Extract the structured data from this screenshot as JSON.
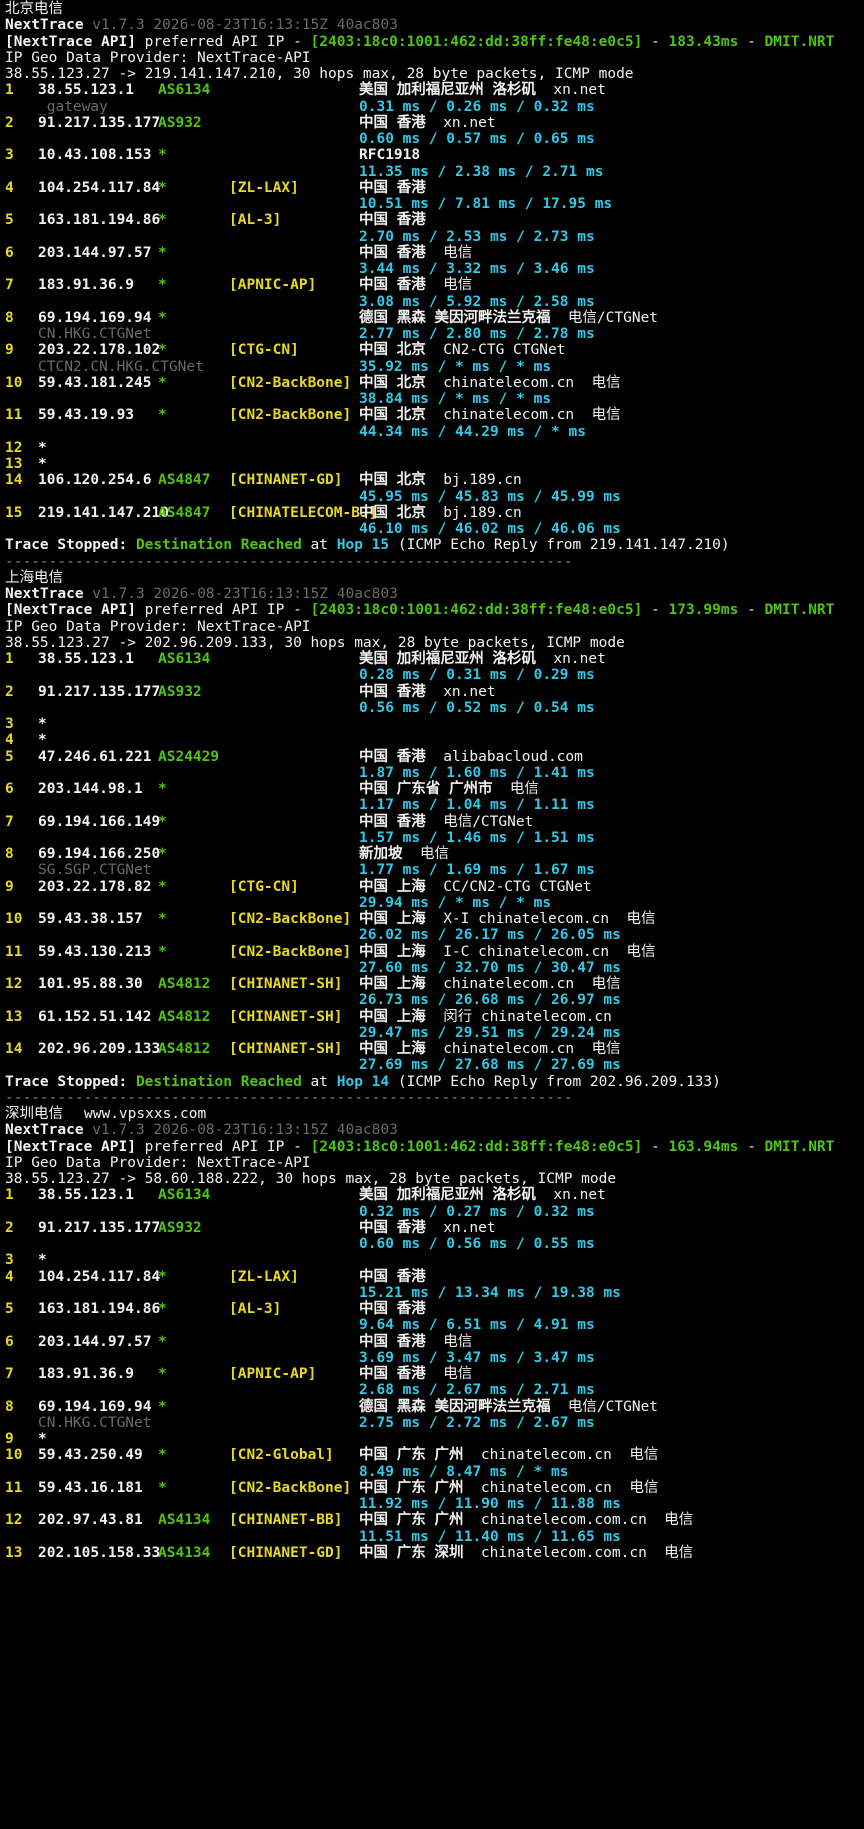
{
  "sections": [
    {
      "caption": "北京电信",
      "header": {
        "name": "NextTrace",
        "version": "v1.7.3 2026-08-23T16:13:15Z 40ac803",
        "api_prefix": "[NextTrace API]",
        "api_mid": " preferred API IP - ",
        "api_ip": "[2403:18c0:1001:462:dd:38ff:fe48:e0c5]",
        "api_dash": " - ",
        "api_latency": "183.43ms",
        "api_dash2": " - ",
        "api_loc": "DMIT.NRT",
        "geo": "IP Geo Data Provider: NextTrace-API",
        "trace": "38.55.123.27 -> 219.141.147.210, 30 hops max, 28 byte packets, ICMP mode"
      },
      "hops": [
        {
          "n": "1",
          "ip": "38.55.123.1",
          "as": "AS6134",
          "tag": "",
          "geo": "美国 加利福尼亚州 洛杉矶",
          "geo2": "xn.net",
          "rdns": "_gateway",
          "rtt": "0.31 ms / 0.26 ms / 0.32 ms"
        },
        {
          "n": "2",
          "ip": "91.217.135.177",
          "as": "AS932",
          "tag": "",
          "geo": "中国 香港",
          "geo2": "xn.net",
          "rdns": "",
          "rtt": "0.60 ms / 0.57 ms / 0.65 ms"
        },
        {
          "n": "3",
          "ip": "10.43.108.153",
          "as": "*",
          "tag": "",
          "geo": "RFC1918",
          "geo2": "",
          "rdns": "",
          "rtt": "11.35 ms / 2.38 ms / 2.71 ms"
        },
        {
          "n": "4",
          "ip": "104.254.117.84",
          "as": "*",
          "tag": "[ZL-LAX]",
          "geo": "中国 香港",
          "geo2": "",
          "rdns": "",
          "rtt": "10.51 ms / 7.81 ms / 17.95 ms"
        },
        {
          "n": "5",
          "ip": "163.181.194.86",
          "as": "*",
          "tag": "[AL-3]",
          "geo": "中国 香港",
          "geo2": "",
          "rdns": "",
          "rtt": "2.70 ms / 2.53 ms / 2.73 ms"
        },
        {
          "n": "6",
          "ip": "203.144.97.57",
          "as": "*",
          "tag": "",
          "geo": "中国 香港",
          "geo2": "电信",
          "rdns": "",
          "rtt": "3.44 ms / 3.32 ms / 3.46 ms"
        },
        {
          "n": "7",
          "ip": "183.91.36.9",
          "as": "*",
          "tag": "[APNIC-AP]",
          "geo": "中国 香港",
          "geo2": "电信",
          "rdns": "",
          "rtt": "3.08 ms / 5.92 ms / 2.58 ms"
        },
        {
          "n": "8",
          "ip": "69.194.169.94",
          "as": "*",
          "tag": "",
          "geo": "德国 黑森 美因河畔法兰克福",
          "geo2": "电信/CTGNet",
          "rdns": "CN.HKG.CTGNet",
          "rtt": "2.77 ms / 2.80 ms / 2.78 ms"
        },
        {
          "n": "9",
          "ip": "203.22.178.102",
          "as": "*",
          "tag": "[CTG-CN]",
          "geo": "中国 北京",
          "geo2": "CN2-CTG CTGNet",
          "rdns": "CTCN2.CN.HKG.CTGNet",
          "rtt": "35.92 ms / * ms / * ms"
        },
        {
          "n": "10",
          "ip": "59.43.181.245",
          "as": "*",
          "tag": "[CN2-BackBone]",
          "geo": "中国 北京",
          "geo2": "chinatelecom.cn  电信",
          "rdns": "",
          "rtt": "38.84 ms / * ms / * ms"
        },
        {
          "n": "11",
          "ip": "59.43.19.93",
          "as": "*",
          "tag": "[CN2-BackBone]",
          "geo": "中国 北京",
          "geo2": "chinatelecom.cn  电信",
          "rdns": "",
          "rtt": "44.34 ms / 44.29 ms / * ms"
        },
        {
          "n": "12",
          "ip": "*",
          "as": "",
          "tag": "",
          "geo": "",
          "geo2": "",
          "rdns": "",
          "rtt": ""
        },
        {
          "n": "13",
          "ip": "*",
          "as": "",
          "tag": "",
          "geo": "",
          "geo2": "",
          "rdns": "",
          "rtt": ""
        },
        {
          "n": "14",
          "ip": "106.120.254.6",
          "as": "AS4847",
          "tag": "[CHINANET-GD]",
          "geo": "中国 北京",
          "geo2": "bj.189.cn",
          "rdns": "",
          "rtt": "45.95 ms / 45.83 ms / 45.99 ms"
        },
        {
          "n": "15",
          "ip": "219.141.147.210",
          "as": "AS4847",
          "tag": "[CHINATELECOM-BJ]",
          "geo": "中国 北京",
          "geo2": "bj.189.cn",
          "rdns": "",
          "rtt": "46.10 ms / 46.02 ms / 46.06 ms"
        }
      ],
      "footer": {
        "a": "Trace Stopped: ",
        "b": "Destination Reached",
        "c": " at ",
        "d": "Hop 15",
        "e": " (ICMP Echo Reply from 219.141.147.210)"
      },
      "separator": "-----------------------------------------------------------------"
    },
    {
      "caption": "上海电信",
      "header": {
        "name": "NextTrace",
        "version": "v1.7.3 2026-08-23T16:13:15Z 40ac803",
        "api_prefix": "[NextTrace API]",
        "api_mid": " preferred API IP - ",
        "api_ip": "[2403:18c0:1001:462:dd:38ff:fe48:e0c5]",
        "api_dash": " - ",
        "api_latency": "173.99ms",
        "api_dash2": " - ",
        "api_loc": "DMIT.NRT",
        "geo": "IP Geo Data Provider: NextTrace-API",
        "trace": "38.55.123.27 -> 202.96.209.133, 30 hops max, 28 byte packets, ICMP mode"
      },
      "hops": [
        {
          "n": "1",
          "ip": "38.55.123.1",
          "as": "AS6134",
          "tag": "",
          "geo": "美国 加利福尼亚州 洛杉矶",
          "geo2": "xn.net",
          "rdns": "",
          "rtt": "0.28 ms / 0.31 ms / 0.29 ms"
        },
        {
          "n": "2",
          "ip": "91.217.135.177",
          "as": "AS932",
          "tag": "",
          "geo": "中国 香港",
          "geo2": "xn.net",
          "rdns": "",
          "rtt": "0.56 ms / 0.52 ms / 0.54 ms"
        },
        {
          "n": "3",
          "ip": "*",
          "as": "",
          "tag": "",
          "geo": "",
          "geo2": "",
          "rdns": "",
          "rtt": ""
        },
        {
          "n": "4",
          "ip": "*",
          "as": "",
          "tag": "",
          "geo": "",
          "geo2": "",
          "rdns": "",
          "rtt": ""
        },
        {
          "n": "5",
          "ip": "47.246.61.221",
          "as": "AS24429",
          "tag": "",
          "geo": "中国 香港",
          "geo2": "alibabacloud.com",
          "rdns": "",
          "rtt": "1.87 ms / 1.60 ms / 1.41 ms"
        },
        {
          "n": "6",
          "ip": "203.144.98.1",
          "as": "*",
          "tag": "",
          "geo": "中国 广东省 广州市",
          "geo2": "电信",
          "rdns": "",
          "rtt": "1.17 ms / 1.04 ms / 1.11 ms"
        },
        {
          "n": "7",
          "ip": "69.194.166.149",
          "as": "*",
          "tag": "",
          "geo": "中国 香港",
          "geo2": "电信/CTGNet",
          "rdns": "",
          "rtt": "1.57 ms / 1.46 ms / 1.51 ms"
        },
        {
          "n": "8",
          "ip": "69.194.166.250",
          "as": "*",
          "tag": "",
          "geo": "新加坡",
          "geo2": "电信",
          "rdns": "SG.SGP.CTGNet",
          "rtt": "1.77 ms / 1.69 ms / 1.67 ms"
        },
        {
          "n": "9",
          "ip": "203.22.178.82",
          "as": "*",
          "tag": "[CTG-CN]",
          "geo": "中国 上海",
          "geo2": "CC/CN2-CTG CTGNet",
          "rdns": "",
          "rtt": "29.94 ms / * ms / * ms"
        },
        {
          "n": "10",
          "ip": "59.43.38.157",
          "as": "*",
          "tag": "[CN2-BackBone]",
          "geo": "中国 上海",
          "geo2": "X-I chinatelecom.cn  电信",
          "rdns": "",
          "rtt": "26.02 ms / 26.17 ms / 26.05 ms"
        },
        {
          "n": "11",
          "ip": "59.43.130.213",
          "as": "*",
          "tag": "[CN2-BackBone]",
          "geo": "中国 上海",
          "geo2": "I-C chinatelecom.cn  电信",
          "rdns": "",
          "rtt": "27.60 ms / 32.70 ms / 30.47 ms"
        },
        {
          "n": "12",
          "ip": "101.95.88.30",
          "as": "AS4812",
          "tag": "[CHINANET-SH]",
          "geo": "中国 上海",
          "geo2": "chinatelecom.cn  电信",
          "rdns": "",
          "rtt": "26.73 ms / 26.68 ms / 26.97 ms"
        },
        {
          "n": "13",
          "ip": "61.152.51.142",
          "as": "AS4812",
          "tag": "[CHINANET-SH]",
          "geo": "中国 上海",
          "geo2": "闵行 chinatelecom.cn",
          "rdns": "",
          "rtt": "29.47 ms / 29.51 ms / 29.24 ms"
        },
        {
          "n": "14",
          "ip": "202.96.209.133",
          "as": "AS4812",
          "tag": "[CHINANET-SH]",
          "geo": "中国 上海",
          "geo2": "chinatelecom.cn  电信",
          "rdns": "",
          "rtt": "27.69 ms / 27.68 ms / 27.69 ms"
        }
      ],
      "footer": {
        "a": "Trace Stopped: ",
        "b": "Destination Reached",
        "c": " at ",
        "d": "Hop 14",
        "e": " (ICMP Echo Reply from 202.96.209.133)"
      },
      "separator": "-----------------------------------------------------------------"
    },
    {
      "caption": "深圳电信",
      "caption_extra": "www.vpsxxs.com",
      "header": {
        "name": "NextTrace",
        "version": "v1.7.3 2026-08-23T16:13:15Z 40ac803",
        "api_prefix": "[NextTrace API]",
        "api_mid": " preferred API IP - ",
        "api_ip": "[2403:18c0:1001:462:dd:38ff:fe48:e0c5]",
        "api_dash": " - ",
        "api_latency": "163.94ms",
        "api_dash2": " - ",
        "api_loc": "DMIT.NRT",
        "geo": "IP Geo Data Provider: NextTrace-API",
        "trace": "38.55.123.27 -> 58.60.188.222, 30 hops max, 28 byte packets, ICMP mode"
      },
      "hops": [
        {
          "n": "1",
          "ip": "38.55.123.1",
          "as": "AS6134",
          "tag": "",
          "geo": "美国 加利福尼亚州 洛杉矶",
          "geo2": "xn.net",
          "rdns": "",
          "rtt": "0.32 ms / 0.27 ms / 0.32 ms"
        },
        {
          "n": "2",
          "ip": "91.217.135.177",
          "as": "AS932",
          "tag": "",
          "geo": "中国 香港",
          "geo2": "xn.net",
          "rdns": "",
          "rtt": "0.60 ms / 0.56 ms / 0.55 ms"
        },
        {
          "n": "3",
          "ip": "*",
          "as": "",
          "tag": "",
          "geo": "",
          "geo2": "",
          "rdns": "",
          "rtt": ""
        },
        {
          "n": "4",
          "ip": "104.254.117.84",
          "as": "*",
          "tag": "[ZL-LAX]",
          "geo": "中国 香港",
          "geo2": "",
          "rdns": "",
          "rtt": "15.21 ms / 13.34 ms / 19.38 ms"
        },
        {
          "n": "5",
          "ip": "163.181.194.86",
          "as": "*",
          "tag": "[AL-3]",
          "geo": "中国 香港",
          "geo2": "",
          "rdns": "",
          "rtt": "9.64 ms / 6.51 ms / 4.91 ms"
        },
        {
          "n": "6",
          "ip": "203.144.97.57",
          "as": "*",
          "tag": "",
          "geo": "中国 香港",
          "geo2": "电信",
          "rdns": "",
          "rtt": "3.69 ms / 3.47 ms / 3.47 ms"
        },
        {
          "n": "7",
          "ip": "183.91.36.9",
          "as": "*",
          "tag": "[APNIC-AP]",
          "geo": "中国 香港",
          "geo2": "电信",
          "rdns": "",
          "rtt": "2.68 ms / 2.67 ms / 2.71 ms"
        },
        {
          "n": "8",
          "ip": "69.194.169.94",
          "as": "*",
          "tag": "",
          "geo": "德国 黑森 美因河畔法兰克福",
          "geo2": "电信/CTGNet",
          "rdns": "CN.HKG.CTGNet",
          "rtt": "2.75 ms / 2.72 ms / 2.67 ms"
        },
        {
          "n": "9",
          "ip": "*",
          "as": "",
          "tag": "",
          "geo": "",
          "geo2": "",
          "rdns": "",
          "rtt": ""
        },
        {
          "n": "10",
          "ip": "59.43.250.49",
          "as": "*",
          "tag": "[CN2-Global]",
          "geo": "中国 广东 广州",
          "geo2": "chinatelecom.cn  电信",
          "rdns": "",
          "rtt": "8.49 ms / 8.47 ms / * ms"
        },
        {
          "n": "11",
          "ip": "59.43.16.181",
          "as": "*",
          "tag": "[CN2-BackBone]",
          "geo": "中国 广东 广州",
          "geo2": "chinatelecom.cn  电信",
          "rdns": "",
          "rtt": "11.92 ms / 11.90 ms / 11.88 ms"
        },
        {
          "n": "12",
          "ip": "202.97.43.81",
          "as": "AS4134",
          "tag": "[CHINANET-BB]",
          "geo": "中国 广东 广州",
          "geo2": "chinatelecom.com.cn  电信",
          "rdns": "",
          "rtt": "11.51 ms / 11.40 ms / 11.65 ms"
        },
        {
          "n": "13",
          "ip": "202.105.158.33",
          "as": "AS4134",
          "tag": "[CHINANET-GD]",
          "geo": "中国 广东 深圳",
          "geo2": "chinatelecom.com.cn  电信",
          "rdns": "",
          "rtt": ""
        }
      ],
      "footer": null,
      "separator": ""
    }
  ]
}
